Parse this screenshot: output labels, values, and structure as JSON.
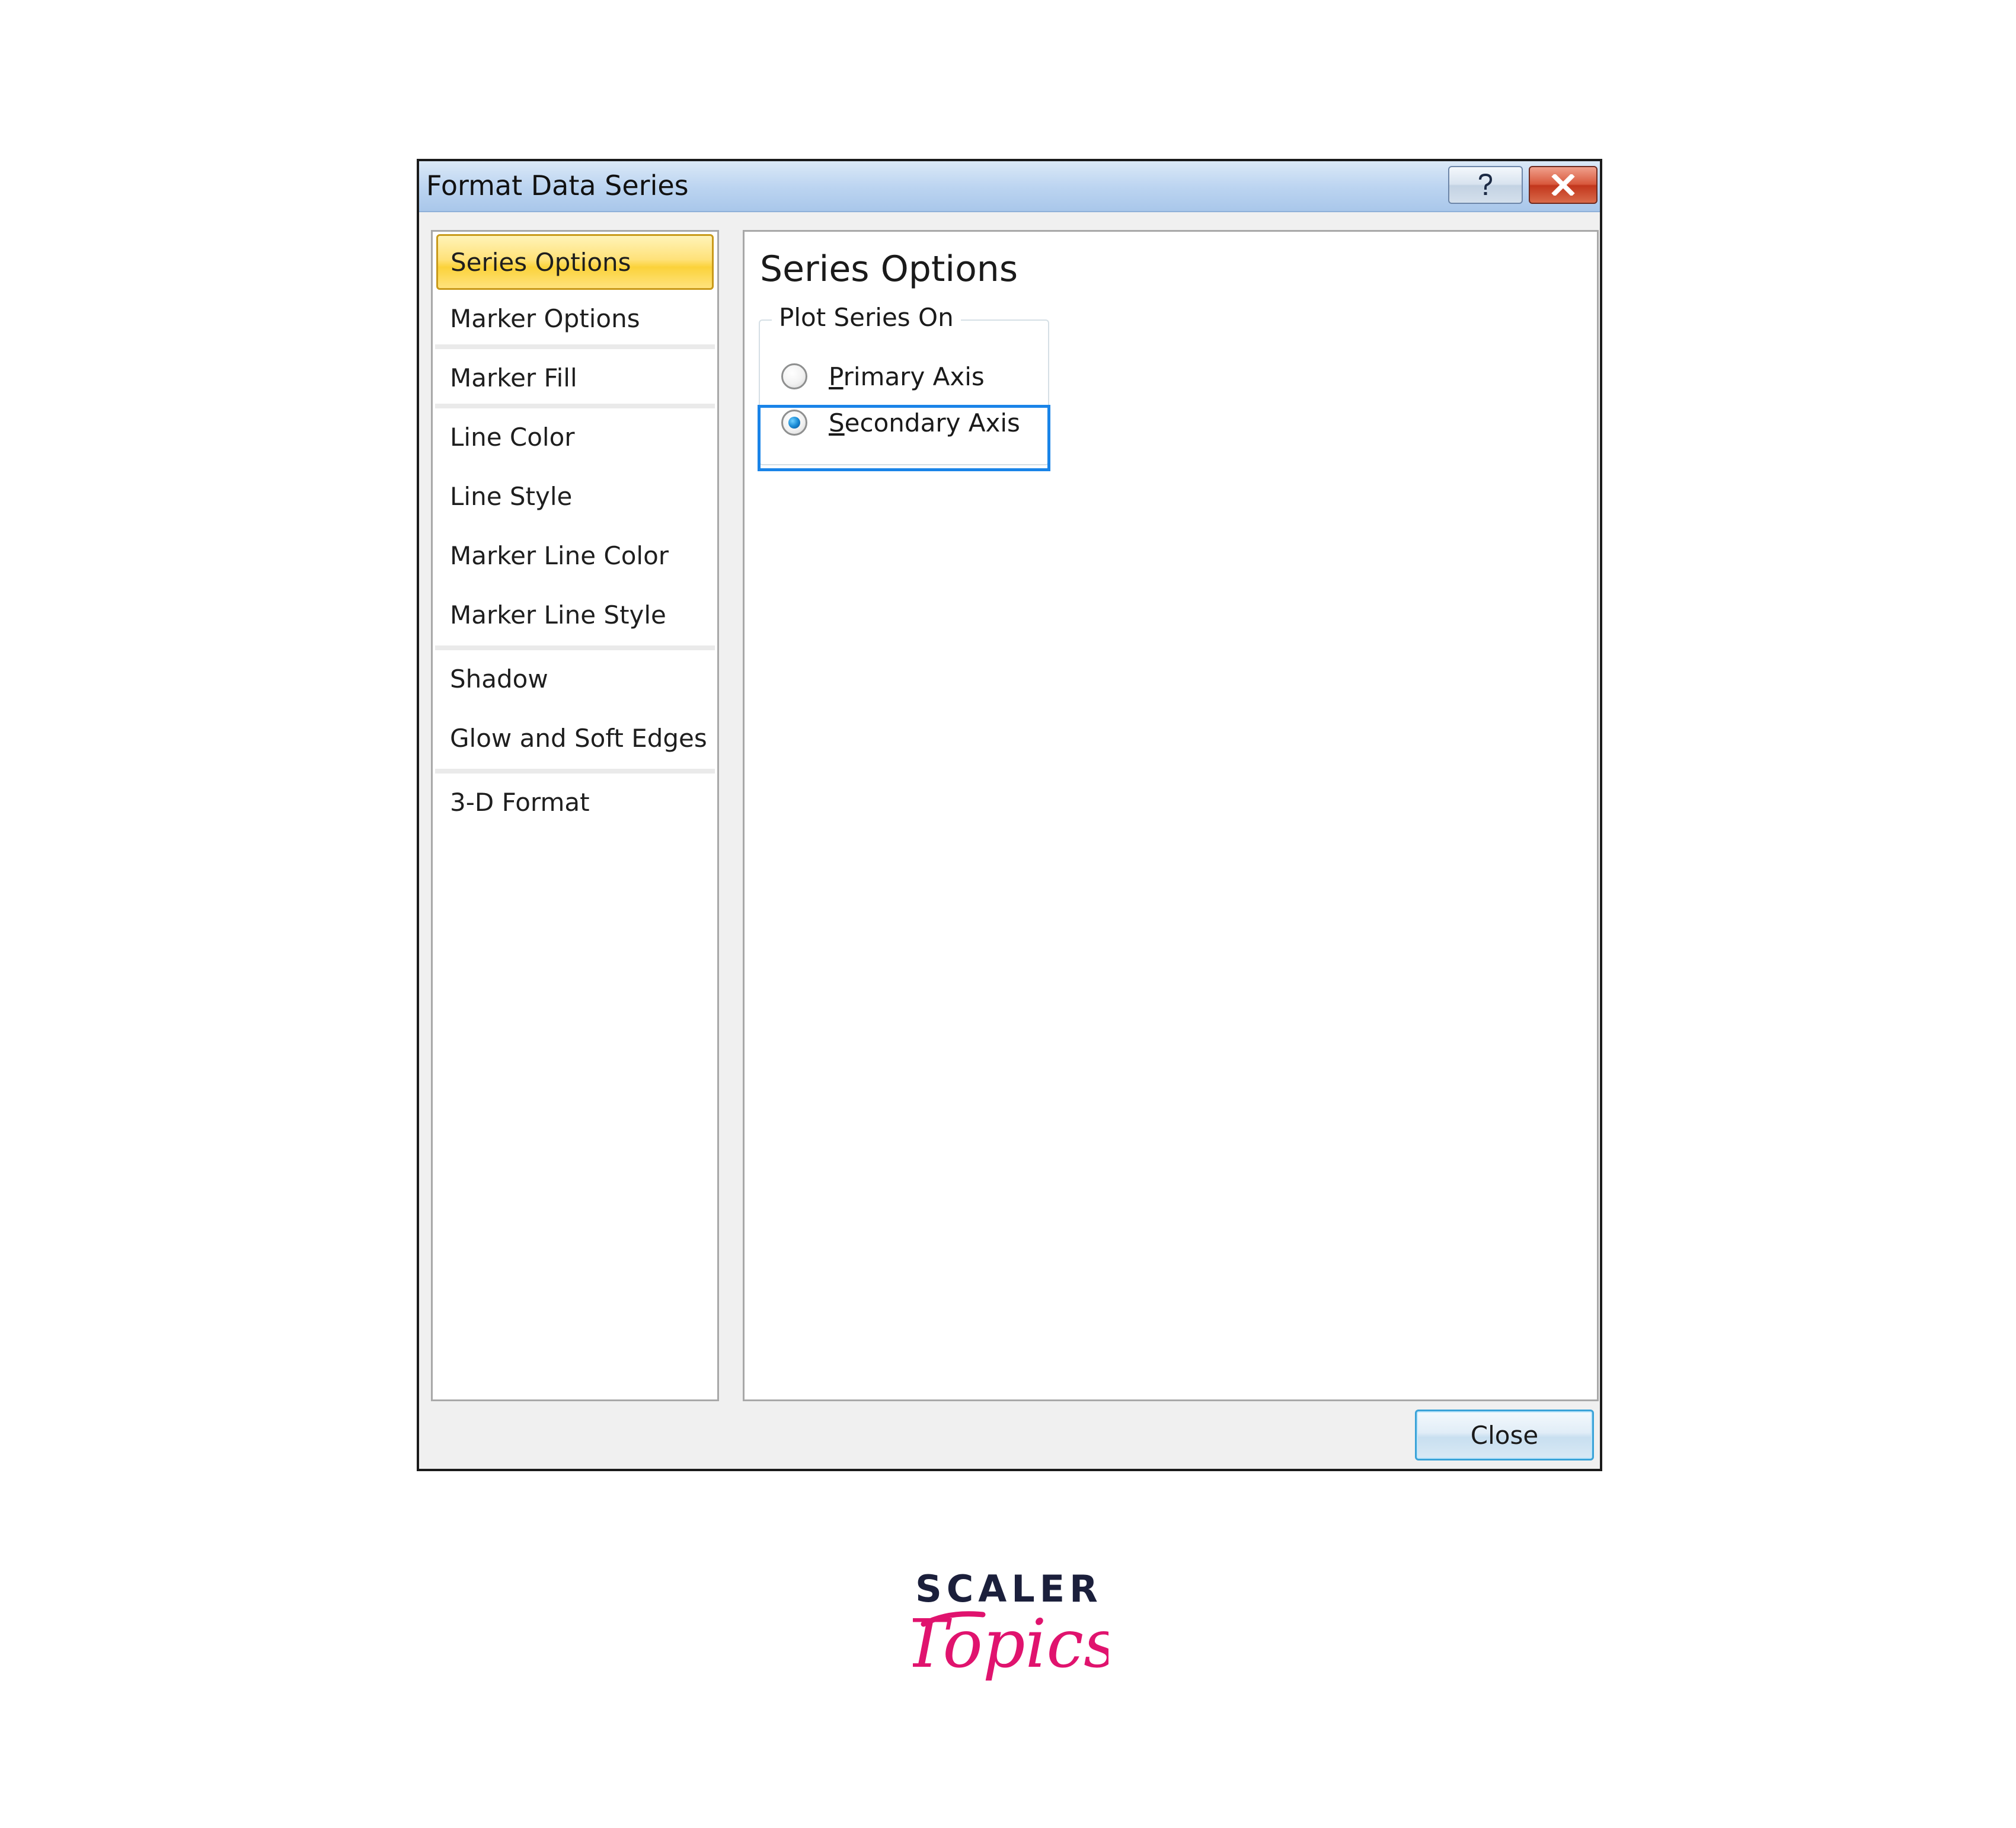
{
  "dialog": {
    "title": "Format Data Series",
    "help_icon": "question-icon",
    "close_icon": "close-x-icon"
  },
  "nav": {
    "items": [
      {
        "label": "Series Options",
        "active": true
      },
      {
        "label": "Marker Options"
      },
      {
        "label": "Marker Fill"
      },
      {
        "label": "Line Color"
      },
      {
        "label": "Line Style"
      },
      {
        "label": "Marker Line Color"
      },
      {
        "label": "Marker Line Style"
      },
      {
        "label": "Shadow"
      },
      {
        "label": "Glow and Soft Edges"
      },
      {
        "label": "3-D Format"
      }
    ]
  },
  "content": {
    "heading": "Series Options",
    "group": {
      "legend": "Plot Series On",
      "options": [
        {
          "mnemonic": "P",
          "rest": "rimary Axis",
          "checked": false
        },
        {
          "mnemonic": "S",
          "rest": "econdary Axis",
          "checked": true
        }
      ]
    }
  },
  "footer": {
    "close_label": "Close"
  },
  "logo": {
    "line1": "SCALER",
    "line2": "Topics"
  },
  "colors": {
    "active_nav": "#ffe27a",
    "highlight": "#1a84e8",
    "logo_dark": "#1b1f3b",
    "logo_pink": "#e0136e"
  }
}
